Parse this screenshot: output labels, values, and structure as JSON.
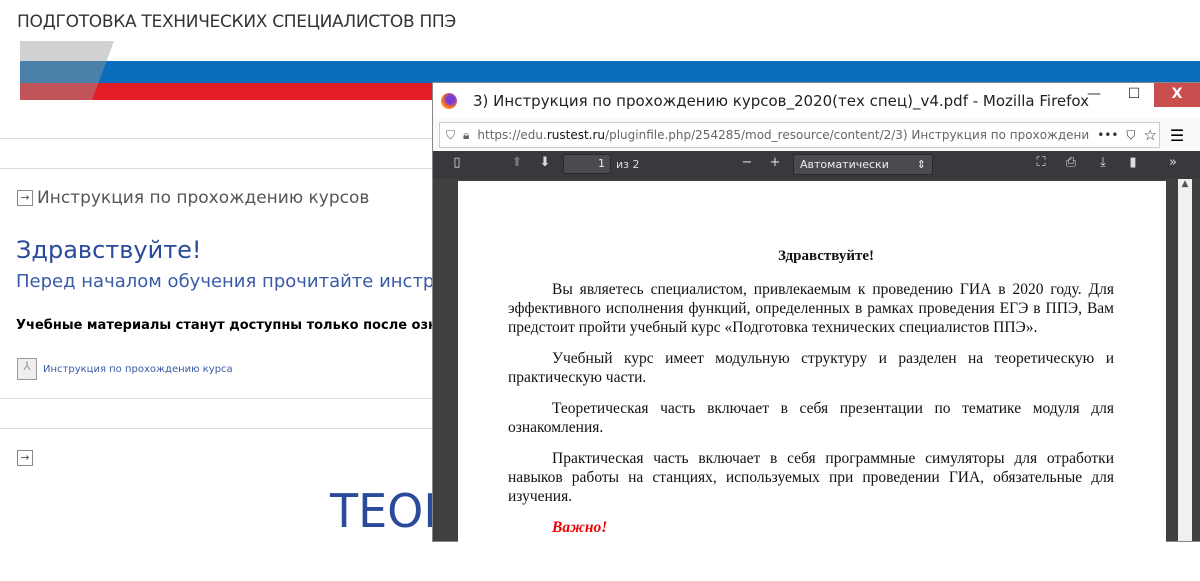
{
  "site": {
    "title": "ПОДГОТОВКА ТЕХНИЧЕСКИХ СПЕЦИАЛИСТОВ ППЭ",
    "section1": "Инструкция по прохождению курсов",
    "hello": "Здравствуйте!",
    "before": "Перед началом обучения прочитайте инструкци",
    "bold_note": "Учебные материалы станут доступны только после ознако",
    "file_link": "Инструкция по прохождению курса",
    "section2_heading": "ТЕОР"
  },
  "colors": {
    "blue": "#2a4a9a",
    "flag_blue": "#0a6dbb",
    "flag_red": "#e21d26"
  },
  "firefox": {
    "title": "3) Инструкция по прохождению курсов_2020(тех спец)_v4.pdf - Mozilla Firefox",
    "url_prefix": "https://edu.",
    "url_domain": "rustest.ru",
    "url_rest": "/pluginfile.php/254285/mod_resource/content/2/3) Инструкция по прохождени",
    "minimize": "—",
    "maximize": "☐",
    "close": "X"
  },
  "pdf": {
    "page": "1",
    "of": "из 2",
    "zoom": "Автоматически",
    "heading": "Здравствуйте!",
    "paragraphs": [
      "Вы являетесь специалистом, привлекаемым к проведению ГИА в 2020 году. Для эффективного исполнения функций, определенных в рамках проведения ЕГЭ в ППЭ, Вам предстоит пройти учебный курс «Подготовка технических специалистов ППЭ».",
      "Учебный курс имеет модульную структуру и разделен на теоретическую и практическую части.",
      "Теоретическая часть включает в себя презентации по тематике модуля для ознакомления.",
      "Практическая часть включает в себя программные симуляторы для отработки навыков работы на станциях, используемых при проведении ГИА, обязательные для изучения."
    ],
    "important": "Важно!"
  }
}
